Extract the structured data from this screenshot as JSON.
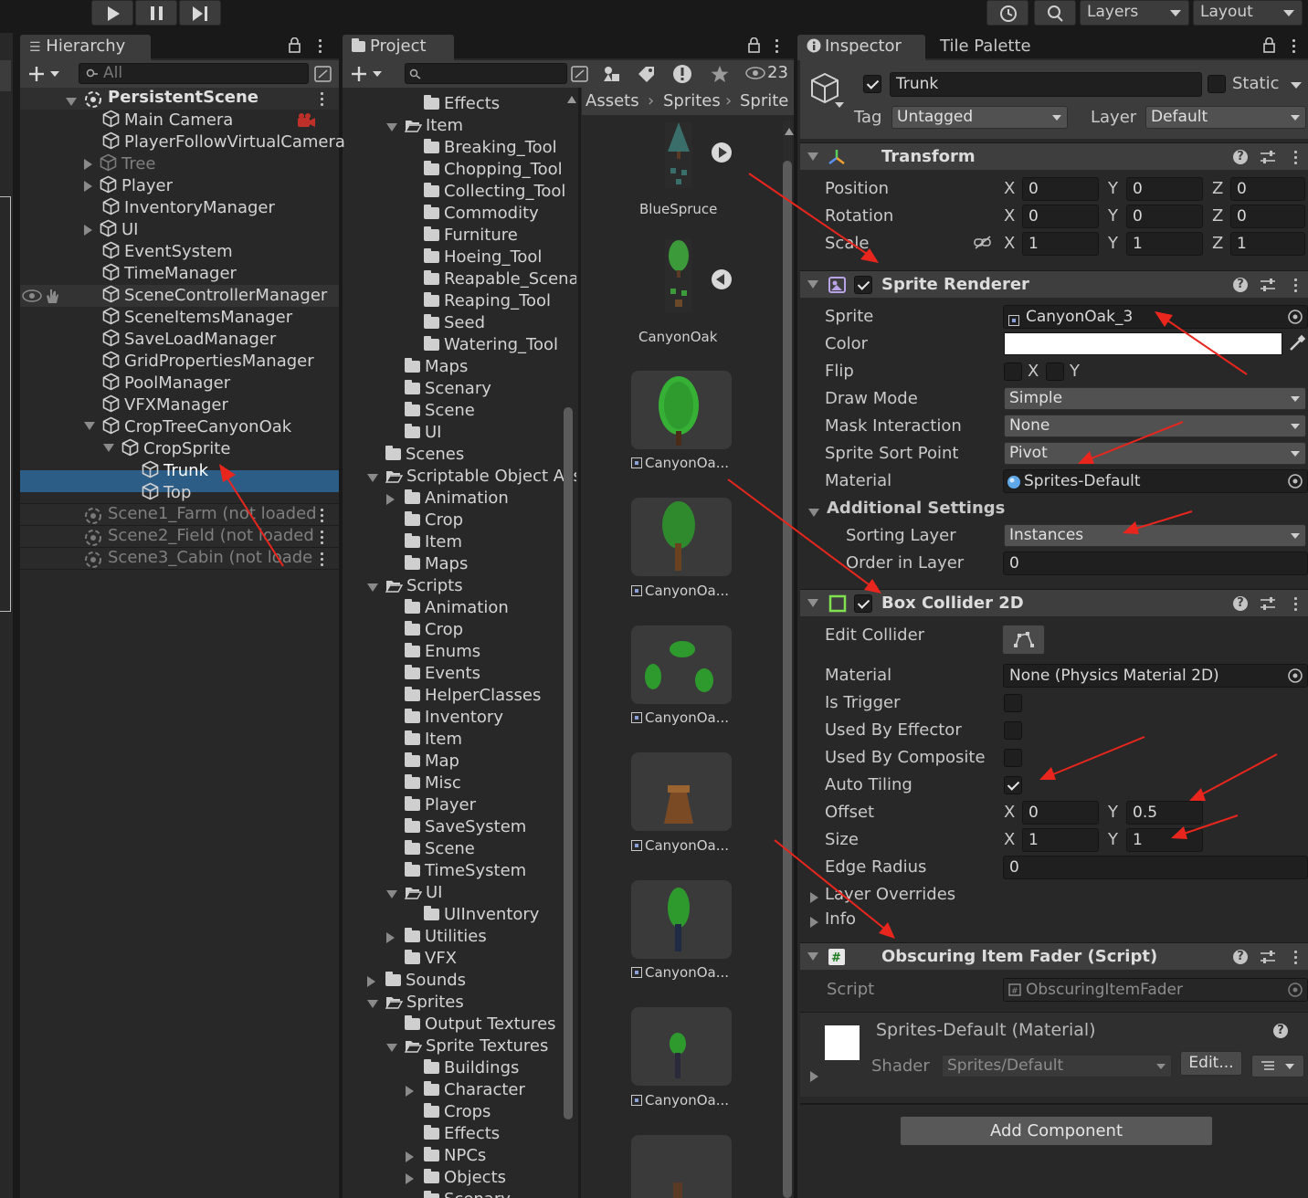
{
  "toolbar": {
    "layers_label": "Layers",
    "layout_label": "Layout"
  },
  "hierarchy": {
    "tab_label": "Hierarchy",
    "search_placeholder": "All",
    "scene_name": "PersistentScene",
    "items": [
      {
        "label": "Main Camera"
      },
      {
        "label": "PlayerFollowVirtualCamera"
      },
      {
        "label": "Tree"
      },
      {
        "label": "Player"
      },
      {
        "label": "InventoryManager"
      },
      {
        "label": "UI"
      },
      {
        "label": "EventSystem"
      },
      {
        "label": "TimeManager"
      },
      {
        "label": "SceneControllerManager"
      },
      {
        "label": "SceneItemsManager"
      },
      {
        "label": "SaveLoadManager"
      },
      {
        "label": "GridPropertiesManager"
      },
      {
        "label": "PoolManager"
      },
      {
        "label": "VFXManager"
      },
      {
        "label": "CropTreeCanyonOak"
      },
      {
        "label": "CropSprite"
      },
      {
        "label": "Trunk"
      },
      {
        "label": "Top"
      }
    ],
    "unloaded_scenes": [
      {
        "label": "Scene1_Farm (not loaded"
      },
      {
        "label": "Scene2_Field (not loaded"
      },
      {
        "label": "Scene3_Cabin (not loade"
      }
    ]
  },
  "project": {
    "tab_label": "Project",
    "hidden_count": "23",
    "breadcrumb": [
      "Assets",
      "Sprites",
      "Sprite T"
    ],
    "tree": [
      {
        "label": "Effects"
      },
      {
        "label": "Item"
      },
      {
        "label": "Breaking_Tool"
      },
      {
        "label": "Chopping_Tool"
      },
      {
        "label": "Collecting_Tool"
      },
      {
        "label": "Commodity"
      },
      {
        "label": "Furniture"
      },
      {
        "label": "Hoeing_Tool"
      },
      {
        "label": "Reapable_Scenary"
      },
      {
        "label": "Reaping_Tool"
      },
      {
        "label": "Seed"
      },
      {
        "label": "Watering_Tool"
      },
      {
        "label": "Maps"
      },
      {
        "label": "Scenary"
      },
      {
        "label": "Scene"
      },
      {
        "label": "UI"
      },
      {
        "label": "Scenes"
      },
      {
        "label": "Scriptable Object Assets"
      },
      {
        "label": "Animation"
      },
      {
        "label": "Crop"
      },
      {
        "label": "Item"
      },
      {
        "label": "Maps"
      },
      {
        "label": "Scripts"
      },
      {
        "label": "Animation"
      },
      {
        "label": "Crop"
      },
      {
        "label": "Enums"
      },
      {
        "label": "Events"
      },
      {
        "label": "HelperClasses"
      },
      {
        "label": "Inventory"
      },
      {
        "label": "Item"
      },
      {
        "label": "Map"
      },
      {
        "label": "Misc"
      },
      {
        "label": "Player"
      },
      {
        "label": "SaveSystem"
      },
      {
        "label": "Scene"
      },
      {
        "label": "TimeSystem"
      },
      {
        "label": "UI"
      },
      {
        "label": "UIInventory"
      },
      {
        "label": "Utilities"
      },
      {
        "label": "VFX"
      },
      {
        "label": "Sounds"
      },
      {
        "label": "Sprites"
      },
      {
        "label": "Output Textures"
      },
      {
        "label": "Sprite Textures"
      },
      {
        "label": "Buildings"
      },
      {
        "label": "Character"
      },
      {
        "label": "Crops"
      },
      {
        "label": "Effects"
      },
      {
        "label": "NPCs"
      },
      {
        "label": "Objects"
      },
      {
        "label": "Scenary"
      }
    ],
    "assets": [
      {
        "label": "BlueSpruce"
      },
      {
        "label": "CanyonOak"
      },
      {
        "label": "CanyonOa..."
      },
      {
        "label": "CanyonOa..."
      },
      {
        "label": "CanyonOa..."
      },
      {
        "label": "CanyonOa..."
      },
      {
        "label": "CanyonOa..."
      },
      {
        "label": "CanyonOa..."
      }
    ]
  },
  "inspector": {
    "tab_label": "Inspector",
    "tab2_label": "Tile Palette",
    "object_name": "Trunk",
    "static_label": "Static",
    "tag_label": "Tag",
    "tag_value": "Untagged",
    "layer_label": "Layer",
    "layer_value": "Default",
    "transform": {
      "title": "Transform",
      "position_label": "Position",
      "rotation_label": "Rotation",
      "scale_label": "Scale",
      "position": [
        "0",
        "0",
        "0"
      ],
      "rotation": [
        "0",
        "0",
        "0"
      ],
      "scale": [
        "1",
        "1",
        "1"
      ],
      "x": "X",
      "y": "Y",
      "z": "Z"
    },
    "sprite_renderer": {
      "title": "Sprite Renderer",
      "sprite_label": "Sprite",
      "sprite_value": "CanyonOak_3",
      "color_label": "Color",
      "color_value": "#ffffff",
      "flip_label": "Flip",
      "draw_mode_label": "Draw Mode",
      "draw_mode_value": "Simple",
      "mask_label": "Mask Interaction",
      "mask_value": "None",
      "sort_point_label": "Sprite Sort Point",
      "sort_point_value": "Pivot",
      "material_label": "Material",
      "material_value": "Sprites-Default",
      "additional_label": "Additional Settings",
      "sorting_layer_label": "Sorting Layer",
      "sorting_layer_value": "Instances",
      "order_label": "Order in Layer",
      "order_value": "0"
    },
    "box_collider": {
      "title": "Box Collider 2D",
      "edit_label": "Edit Collider",
      "material_label": "Material",
      "material_value": "None (Physics Material 2D)",
      "trigger_label": "Is Trigger",
      "effector_label": "Used By Effector",
      "composite_label": "Used By Composite",
      "auto_tiling_label": "Auto Tiling",
      "offset_label": "Offset",
      "offset": [
        "0",
        "0.5"
      ],
      "size_label": "Size",
      "size": [
        "1",
        "1"
      ],
      "edge_label": "Edge Radius",
      "edge_value": "0",
      "layer_overrides_label": "Layer Overrides",
      "info_label": "Info"
    },
    "script_comp": {
      "title": "Obscuring Item Fader (Script)",
      "script_label": "Script",
      "script_value": "ObscuringItemFader"
    },
    "material": {
      "title": "Sprites-Default (Material)",
      "shader_label": "Shader",
      "shader_value": "Sprites/Default",
      "edit_label": "Edit..."
    },
    "add_component": "Add Component"
  },
  "colors": {
    "selection": "#2c5d87",
    "annotation_arrow": "#e8261d"
  }
}
